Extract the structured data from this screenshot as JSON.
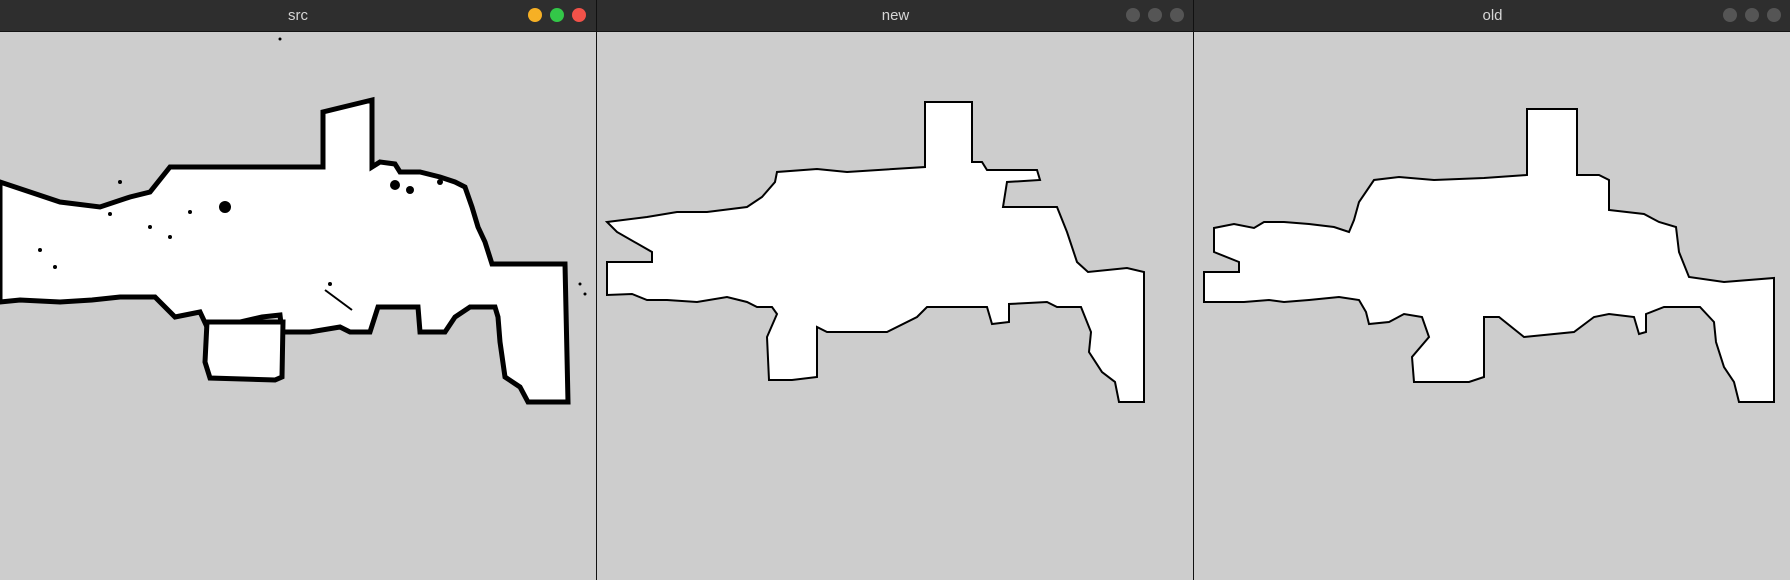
{
  "windows": [
    {
      "title": "src",
      "active": true
    },
    {
      "title": "new",
      "active": false
    },
    {
      "title": "old",
      "active": false
    }
  ],
  "colors": {
    "titlebar": "#2e2e2e",
    "canvas": "#cdcdcd",
    "light_minimize": "#f6b025",
    "light_zoom": "#33c748",
    "light_close": "#f25249",
    "light_inactive": "#555555"
  },
  "icons": [
    "minimize-button-icon",
    "zoom-button-icon",
    "close-button-icon"
  ]
}
